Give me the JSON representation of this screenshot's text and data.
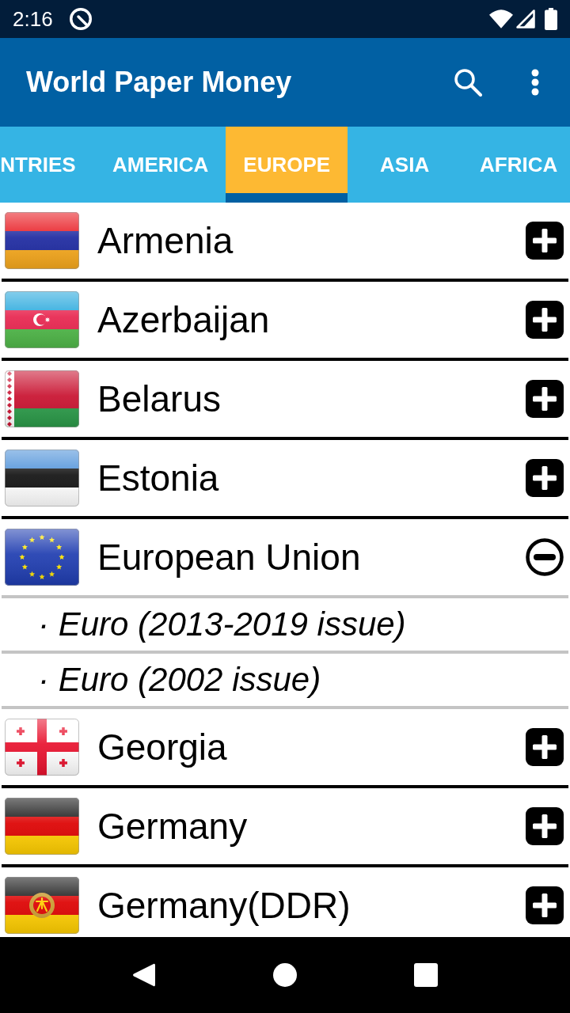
{
  "status_bar": {
    "time": "2:16"
  },
  "app_bar": {
    "title": "World Paper Money"
  },
  "tabs": [
    {
      "label": "NTRIES",
      "selected": false
    },
    {
      "label": "AMERICA",
      "selected": false
    },
    {
      "label": "EUROPE",
      "selected": true
    },
    {
      "label": "ASIA",
      "selected": false
    },
    {
      "label": "AFRICA",
      "selected": false
    }
  ],
  "list": {
    "items": [
      {
        "name": "Armenia",
        "expanded": false
      },
      {
        "name": "Azerbaijan",
        "expanded": false
      },
      {
        "name": "Belarus",
        "expanded": false
      },
      {
        "name": "Estonia",
        "expanded": false
      },
      {
        "name": "European Union",
        "expanded": true,
        "children": [
          {
            "label": "· Euro (2013-2019 issue)"
          },
          {
            "label": "· Euro (2002 issue)"
          }
        ]
      },
      {
        "name": "Georgia",
        "expanded": false
      },
      {
        "name": "Germany",
        "expanded": false
      },
      {
        "name": "Germany(DDR)",
        "expanded": false
      }
    ]
  }
}
